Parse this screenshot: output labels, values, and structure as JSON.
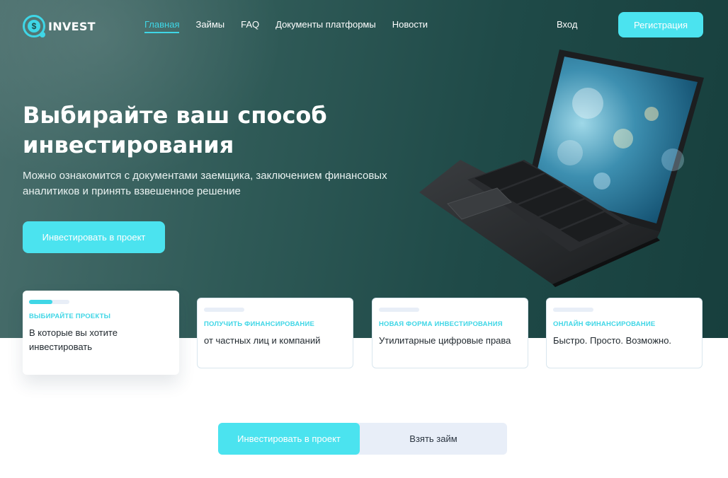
{
  "brand": {
    "name": "INVEST",
    "icon_glyph": "$"
  },
  "nav": {
    "items": [
      {
        "label": "Главная",
        "active": true
      },
      {
        "label": "Займы"
      },
      {
        "label": "FAQ"
      },
      {
        "label": "Документы платформы"
      },
      {
        "label": "Новости"
      }
    ],
    "login_label": "Вход",
    "register_label": "Регистрация"
  },
  "hero": {
    "title_line1": "Выбирайте ваш способ",
    "title_line2": "инвестирования",
    "subtitle_line1": "Можно ознакомится с документами заемщика, заключением финансовых",
    "subtitle_line2": "аналитиков и принять взвешенное решение",
    "cta_label": "Инвестировать в проект",
    "image": "laptop"
  },
  "cards": [
    {
      "title": "Выбирайте проекты",
      "text_line1": "В которые вы хотите",
      "text_line2": "инвестировать",
      "progress": 0.58
    },
    {
      "title": "Получить финансирование",
      "text_line1": "от частных лиц и компаний",
      "text_line2": ""
    },
    {
      "title": "Новая форма инвестирования",
      "text_line1": "Утилитарные цифровые права",
      "text_line2": ""
    },
    {
      "title": "Онлайн финансирование",
      "text_line1": "Быстро. Просто. Возможно.",
      "text_line2": ""
    }
  ],
  "tabs": [
    {
      "label": "Инвестировать в проект",
      "active": true
    },
    {
      "label": "Взять займ"
    }
  ],
  "colors": {
    "accent": "#4be3ef",
    "accent_text": "#3fd6e6",
    "hero_bg_dark": "#173f3d",
    "hero_bg_light": "#4a6f6d",
    "tab_bg": "#e8eef8"
  }
}
